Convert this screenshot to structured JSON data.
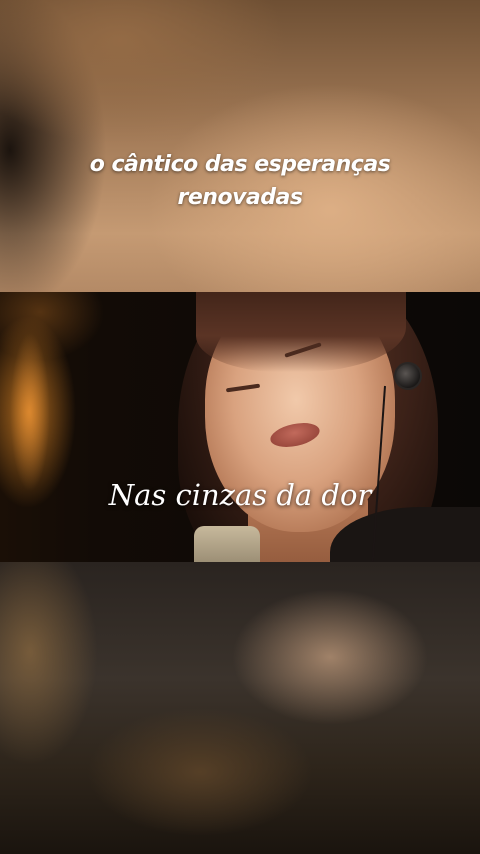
{
  "overlay": {
    "title_line_1": "o cântico das esperanças",
    "title_line_2": "renovadas"
  },
  "video": {
    "subtitle": "Nas cinzas da dor"
  }
}
